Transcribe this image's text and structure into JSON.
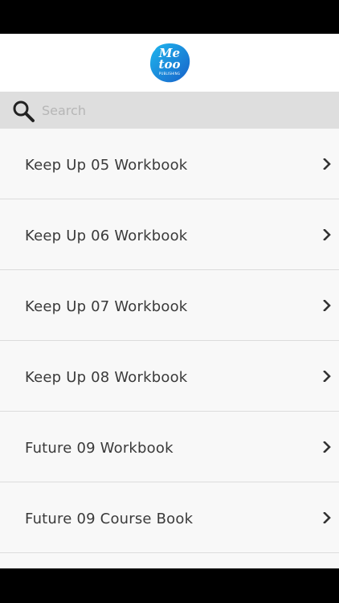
{
  "app": {
    "logo": {
      "line1": "Me",
      "line2": "too",
      "subtitle": "PUBLISHING",
      "colors": {
        "primary": "#1d7fd6",
        "secondary": "#1fb7ee",
        "text": "#ffffff"
      }
    }
  },
  "search": {
    "placeholder": "Search",
    "value": "",
    "icon": "search-icon"
  },
  "list": {
    "items": [
      {
        "label": "Keep Up 05 Workbook",
        "icon": "chevron-right-icon"
      },
      {
        "label": "Keep Up 06 Workbook",
        "icon": "chevron-right-icon"
      },
      {
        "label": "Keep Up 07 Workbook",
        "icon": "chevron-right-icon"
      },
      {
        "label": "Keep Up 08 Workbook",
        "icon": "chevron-right-icon"
      },
      {
        "label": "Future 09 Workbook",
        "icon": "chevron-right-icon"
      },
      {
        "label": "Future 09 Course Book",
        "icon": "chevron-right-icon"
      },
      {
        "label": "",
        "icon": "chevron-right-icon"
      }
    ]
  },
  "colors": {
    "header_bg": "#ffffff",
    "search_bg": "#dedede",
    "list_bg": "#f8f8f8",
    "divider": "#dcdcdc",
    "text": "#3a3a3a",
    "placeholder": "#b6b6b6"
  }
}
